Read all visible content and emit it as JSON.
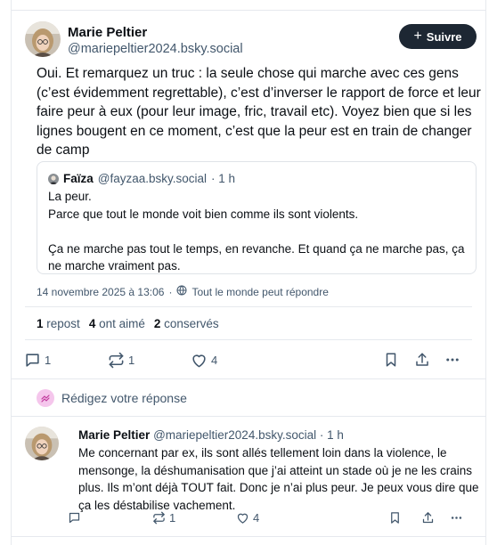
{
  "post": {
    "author_name": "Marie Peltier",
    "author_handle": "@mariepeltier2024.bsky.social",
    "follow_label": "Suivre",
    "text": "Oui. Et remarquez un truc : la seule chose qui marche avec ces gens (c’est évidemment regrettable), c’est d’inverser le rapport de force et leur faire peur à eux (pour leur image, fric, travail etc). Voyez bien que si les lignes bougent en ce moment, c’est que la peur est en train de changer de camp",
    "quote": {
      "author_name": "Faïza",
      "author_handle": "@fayzaa.bsky.social",
      "time": "· 1 h",
      "line1": "La peur.",
      "line2": "Parce que tout le monde voit bien comme ils sont violents.",
      "line3": "Ça ne marche pas tout le temps, en revanche. Et quand ça ne marche pas, ça ne marche vraiment pas."
    },
    "date": "14 novembre 2025 à 13:06",
    "separator": "·",
    "reply_setting": "Tout le monde peut répondre",
    "stats": {
      "reposts_count": "1",
      "reposts_label": "repost",
      "likes_count": "4",
      "likes_label": "ont aimé",
      "saves_count": "2",
      "saves_label": "conservés"
    },
    "actions": {
      "reply_count": "1",
      "repost_count": "1",
      "like_count": "4"
    }
  },
  "composer": {
    "placeholder": "Rédigez votre réponse"
  },
  "reply": {
    "author_name": "Marie Peltier",
    "author_handle": "@mariepeltier2024.bsky.social",
    "time": "· 1 h",
    "text": "Me concernant par ex, ils sont allés tellement loin dans la violence, le mensonge, la déshumanisation que j’ai atteint un stade où je ne les crains plus. Ils m’ont déjà TOUT fait. Donc je n’ai plus peur. Je peux vous dire que ça les déstabilise vachement.",
    "actions": {
      "reply_count": "",
      "repost_count": "1",
      "like_count": "4"
    }
  },
  "colors": {
    "text": "#0b0f14",
    "muted": "#42576c",
    "border": "#e6e9ee",
    "button_bg": "#1d2733",
    "reply_icon_bg": "#f5c6ec",
    "reply_icon_fg": "#c0379b"
  },
  "icons": [
    "plus-icon",
    "globe-icon",
    "comment-icon",
    "repost-icon",
    "heart-icon",
    "bookmark-icon",
    "share-icon",
    "more-icon",
    "reply-compose-icon"
  ]
}
